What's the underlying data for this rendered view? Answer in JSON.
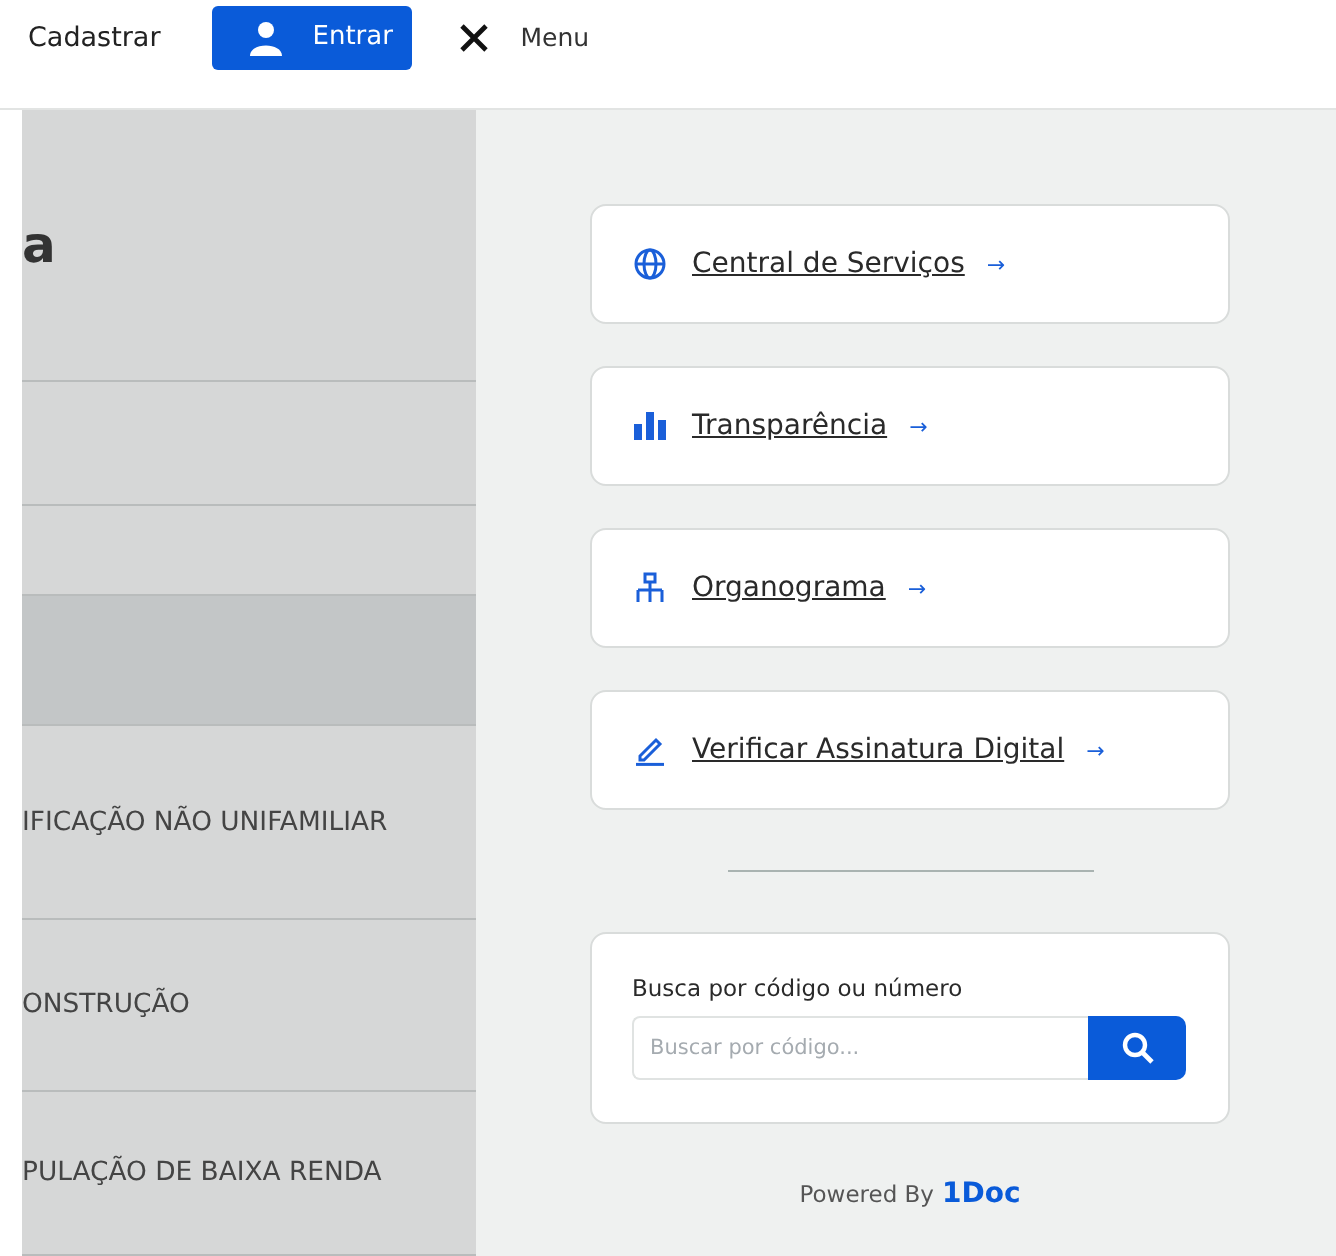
{
  "header": {
    "signup": "Cadastrar",
    "login": "Entrar",
    "menu": "Menu"
  },
  "side_panel": {
    "heading": "a",
    "rows": [
      {
        "selected": false
      },
      {
        "selected": false
      },
      {
        "selected": true
      },
      {
        "selected": false,
        "label": "IFICAÇÃO NÃO UNIFAMILIAR"
      },
      {
        "selected": false,
        "label": "ONSTRUÇÃO"
      },
      {
        "selected": false,
        "label": "PULAÇÃO DE BAIXA RENDA"
      }
    ]
  },
  "links": [
    {
      "kind": "globe",
      "label": "Central de Serviços",
      "arrow": "→"
    },
    {
      "kind": "chart",
      "label": "Transparência",
      "arrow": "→"
    },
    {
      "kind": "org",
      "label": "Organograma",
      "arrow": "→"
    },
    {
      "kind": "pen",
      "label": "Verificar Assinatura Digital",
      "arrow": "→"
    }
  ],
  "search": {
    "label": "Busca por código ou número",
    "placeholder": "Buscar por código..."
  },
  "footer": {
    "powered": "Powered By",
    "brand": "1Doc"
  }
}
